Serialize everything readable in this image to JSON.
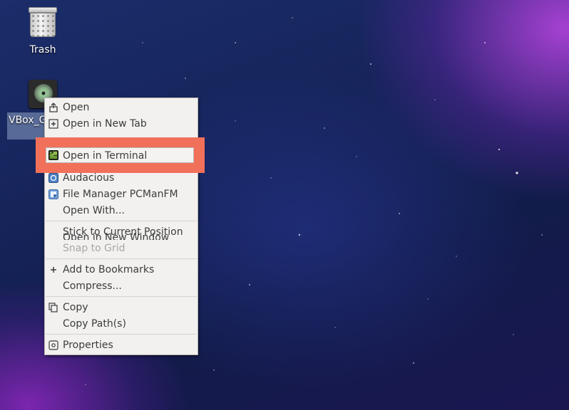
{
  "desktop": {
    "icons": [
      {
        "label": "Trash"
      },
      {
        "label": "VBox_GAs"
      }
    ]
  },
  "context_menu": {
    "items": [
      {
        "label": "Open",
        "icon": "open-icon",
        "enabled": true
      },
      {
        "label": "Open in New Tab",
        "icon": "new-tab-plus-icon",
        "enabled": true
      },
      {
        "label": "Open in New Window",
        "icon": "new-window-icon",
        "enabled": true
      },
      {
        "label": "Open in Terminal",
        "icon": "terminal-icon",
        "enabled": true,
        "highlighted": true
      },
      {
        "label": "Audacious",
        "icon": "audacious-icon",
        "enabled": true
      },
      {
        "label": "File Manager PCManFM",
        "icon": "file-manager-icon",
        "enabled": true
      },
      {
        "label": "Open With...",
        "icon": "",
        "enabled": true
      },
      {
        "label": "Stick to Current Position",
        "icon": "",
        "enabled": true
      },
      {
        "label": "Snap to Grid",
        "icon": "",
        "enabled": false
      },
      {
        "label": "Add to Bookmarks",
        "icon": "plus-icon",
        "enabled": true
      },
      {
        "label": "Compress...",
        "icon": "",
        "enabled": true
      },
      {
        "label": "Copy",
        "icon": "copy-icon",
        "enabled": true
      },
      {
        "label": "Copy Path(s)",
        "icon": "",
        "enabled": true
      },
      {
        "label": "Properties",
        "icon": "properties-icon",
        "enabled": true
      }
    ]
  },
  "colors": {
    "highlight_box": "#f1705a",
    "menu_background": "#f2f1f0",
    "disabled_text": "#a6a6a6"
  }
}
